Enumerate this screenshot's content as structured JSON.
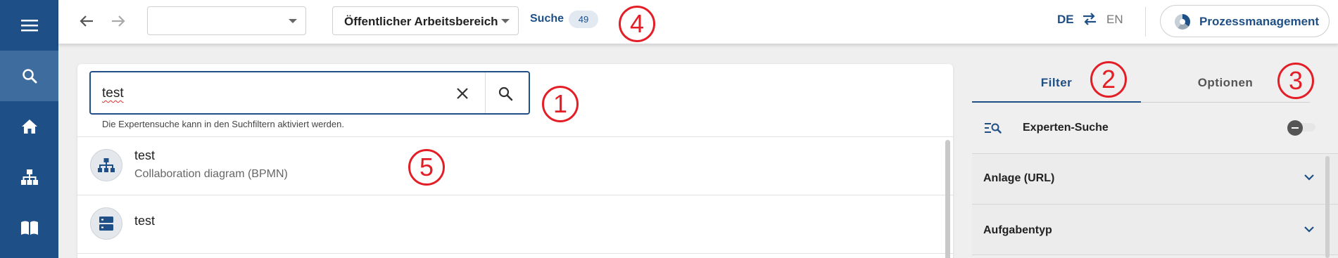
{
  "sidebar": {
    "items": [
      {
        "name": "menu",
        "icon": "hamburger-icon"
      },
      {
        "name": "search",
        "icon": "search-icon",
        "active": true
      },
      {
        "name": "home",
        "icon": "home-icon"
      },
      {
        "name": "hierarchy",
        "icon": "hierarchy-icon"
      },
      {
        "name": "book",
        "icon": "book-open-icon"
      }
    ]
  },
  "header": {
    "back_icon": "arrow-left-icon",
    "forward_icon": "arrow-right-icon",
    "first_select_value": "",
    "workspace_select_value": "Öffentlicher Arbeitsbereich",
    "search_label": "Suche",
    "search_count": "49",
    "lang_active": "DE",
    "lang_inactive": "EN",
    "app_button_label": "Prozessmanagement"
  },
  "search": {
    "query": "test",
    "hint": "Die Expertensuche kann in den Suchfiltern aktiviert werden."
  },
  "results": [
    {
      "title": "test",
      "subtitle": "Collaboration diagram (BPMN)",
      "icon": "diagram-icon"
    },
    {
      "title": "test",
      "subtitle": "",
      "icon": "server-icon"
    }
  ],
  "panel": {
    "tabs": [
      {
        "label": "Filter",
        "active": true
      },
      {
        "label": "Optionen",
        "active": false
      }
    ],
    "expert_search_label": "Experten-Suche",
    "expert_search_enabled": false,
    "filters": [
      {
        "label": "Anlage (URL)"
      },
      {
        "label": "Aufgabentyp"
      }
    ]
  },
  "markers": [
    "1",
    "2",
    "3",
    "4",
    "5"
  ],
  "colors": {
    "brand": "#1e4f86",
    "marker": "#e41e26"
  }
}
